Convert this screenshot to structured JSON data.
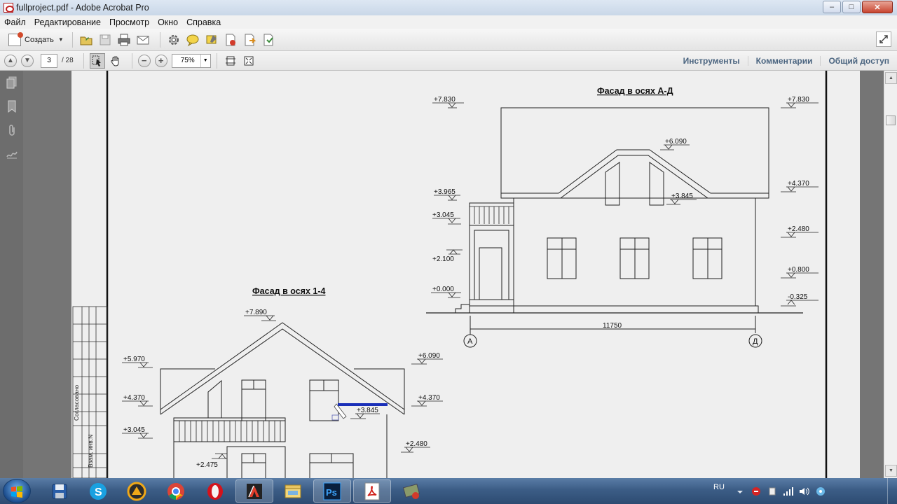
{
  "window": {
    "title": "fullproject.pdf - Adobe Acrobat Pro"
  },
  "menu": [
    "Файл",
    "Редактирование",
    "Просмотр",
    "Окно",
    "Справка"
  ],
  "toolbar": {
    "create_label": "Создать"
  },
  "nav": {
    "current_page": "3",
    "total_pages": "/ 28",
    "zoom": "75%",
    "links": [
      "Инструменты",
      "Комментарии",
      "Общий доступ"
    ]
  },
  "drawing": {
    "facade_right": {
      "title": "Фасад в осях А-Д",
      "levels_left": [
        "+7.830",
        "+3.965",
        "+3.045",
        "+2.100",
        "+0.000"
      ],
      "levels_right": [
        "+7.830",
        "+4.370",
        "+2.480",
        "+0.800",
        "-0.325"
      ],
      "level_ridge": "+6.090",
      "level_mid": "+3.845",
      "dimension": "11750",
      "axis_left": "А",
      "axis_right": "Д"
    },
    "facade_left": {
      "title": "Фасад в осях 1-4",
      "level_ridge": "+7.890",
      "levels_left": [
        "+5.970",
        "+4.370",
        "+3.045",
        "+2.475"
      ],
      "levels_right": [
        "+6.090",
        "+4.370",
        "+2.480"
      ],
      "level_mid": "+3.845"
    },
    "stamp": {
      "approved": "Согласовано",
      "inv": "Взам. инв.N"
    }
  },
  "taskbar": {
    "tray_lang": "RU",
    "apps": [
      "save-app-icon",
      "skype-icon",
      "archicad-icon",
      "chrome-icon",
      "opera-icon",
      "autocad-icon",
      "explorer-icon",
      "photoshop-icon",
      "acrobat-icon",
      "map-app-icon"
    ],
    "photoshop_label": "Ps"
  }
}
